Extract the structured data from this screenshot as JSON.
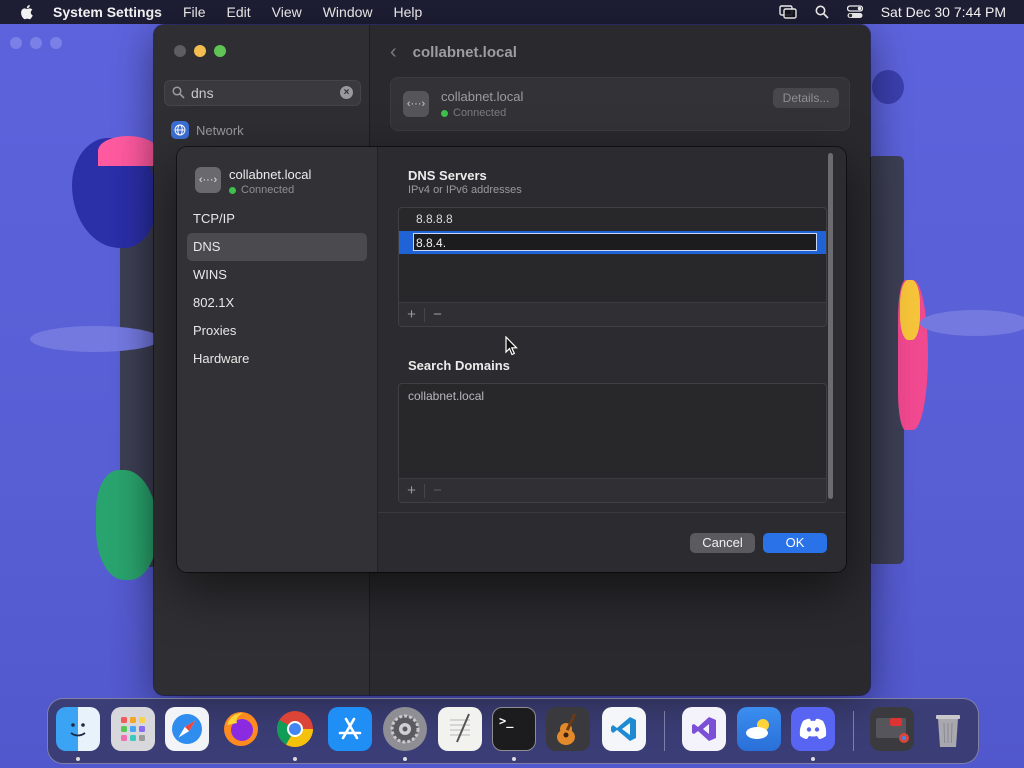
{
  "menubar": {
    "app": "System Settings",
    "items": [
      "File",
      "Edit",
      "View",
      "Window",
      "Help"
    ],
    "datetime": "Sat Dec 30  7:44 PM"
  },
  "settings": {
    "search": {
      "value": "dns"
    },
    "sidebar_result": "Network",
    "header_title": "collabnet.local",
    "connection": {
      "name": "collabnet.local",
      "status": "Connected",
      "details_label": "Details..."
    }
  },
  "sheet": {
    "connection": {
      "name": "collabnet.local",
      "status": "Connected",
      "icon": "‹···›"
    },
    "nav": [
      "TCP/IP",
      "DNS",
      "WINS",
      "802.1X",
      "Proxies",
      "Hardware"
    ],
    "selected_nav": "DNS",
    "dns": {
      "title": "DNS Servers",
      "subtitle": "IPv4 or IPv6 addresses",
      "servers": [
        "8.8.8.8"
      ],
      "editing_value": "8.8.4."
    },
    "search_domains": {
      "title": "Search Domains",
      "items": [
        "collabnet.local"
      ]
    },
    "plus": "+",
    "minus": "−",
    "cancel_label": "Cancel",
    "ok_label": "OK"
  },
  "dock": {
    "apps": [
      "Finder",
      "Launchpad",
      "Safari",
      "Firefox",
      "Chrome",
      "App Store",
      "System Settings",
      "TextEdit",
      "Terminal",
      "GarageBand",
      "VS Code",
      "Visual Studio",
      "Weather",
      "Discord",
      "Downloads",
      "Trash"
    ],
    "terminal_glyph": ">_"
  },
  "colors": {
    "accent": "#2a72e8",
    "selection": "#1f63d6",
    "connected": "#3fbf4f"
  }
}
